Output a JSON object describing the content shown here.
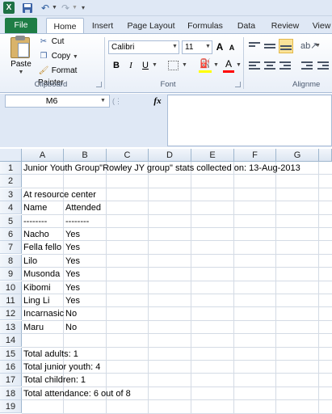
{
  "titlebar": {
    "app_icon": "X",
    "icons": [
      "excel-logo-icon",
      "save-icon",
      "undo-icon",
      "redo-icon",
      "customize-qat-icon"
    ]
  },
  "tabs": [
    "File",
    "Home",
    "Insert",
    "Page Layout",
    "Formulas",
    "Data",
    "Review",
    "View"
  ],
  "ribbon": {
    "clipboard": {
      "group_label": "Clipboard",
      "paste": "Paste",
      "cut": "Cut",
      "copy": "Copy",
      "format_painter": "Format Painter"
    },
    "font": {
      "group_label": "Font",
      "font_name": "Calibri",
      "font_size": "11",
      "bold": "B",
      "italic": "I",
      "underline": "U",
      "grow": "A",
      "shrink": "A",
      "font_color_glyph": "A",
      "fill_color": "#ffff00",
      "font_color": "#ff0000"
    },
    "alignment": {
      "group_label": "Alignme"
    }
  },
  "formula_bar": {
    "name_box": "M6",
    "fx": "fx",
    "formula": ""
  },
  "grid": {
    "columns": [
      "A",
      "B",
      "C",
      "D",
      "E",
      "F",
      "G"
    ],
    "rows": [
      "1",
      "2",
      "3",
      "4",
      "5",
      "6",
      "7",
      "8",
      "9",
      "10",
      "11",
      "12",
      "13",
      "14",
      "15",
      "16",
      "17",
      "18",
      "19"
    ],
    "cells": [
      {
        "ref": "A1",
        "text": "Junior Youth Group\"Rowley JY group\" stats collected on: 13-Aug-2013"
      },
      {
        "ref": "A3",
        "text": "At resource center"
      },
      {
        "ref": "A4",
        "text": "Name"
      },
      {
        "ref": "B4",
        "text": "Attended"
      },
      {
        "ref": "A5",
        "text": "--------"
      },
      {
        "ref": "B5",
        "text": "--------"
      },
      {
        "ref": "A6",
        "text": "Nacho"
      },
      {
        "ref": "B6",
        "text": "Yes"
      },
      {
        "ref": "A7",
        "text": "Fella fello"
      },
      {
        "ref": "B7",
        "text": "Yes"
      },
      {
        "ref": "A8",
        "text": "Lilo"
      },
      {
        "ref": "B8",
        "text": "Yes"
      },
      {
        "ref": "A9",
        "text": "Musonda"
      },
      {
        "ref": "B9",
        "text": "Yes"
      },
      {
        "ref": "A10",
        "text": "Kibomi"
      },
      {
        "ref": "B10",
        "text": "Yes"
      },
      {
        "ref": "A11",
        "text": "Ling Li"
      },
      {
        "ref": "B11",
        "text": "Yes"
      },
      {
        "ref": "A12",
        "text": "Incarnasic"
      },
      {
        "ref": "B12",
        "text": "No"
      },
      {
        "ref": "A13",
        "text": "Maru"
      },
      {
        "ref": "B13",
        "text": "No"
      },
      {
        "ref": "A15",
        "text": "Total adults: 1"
      },
      {
        "ref": "A16",
        "text": "Total junior youth: 4"
      },
      {
        "ref": "A17",
        "text": "Total children: 1"
      },
      {
        "ref": "A18",
        "text": "Total attendance: 6 out of 8"
      }
    ]
  }
}
